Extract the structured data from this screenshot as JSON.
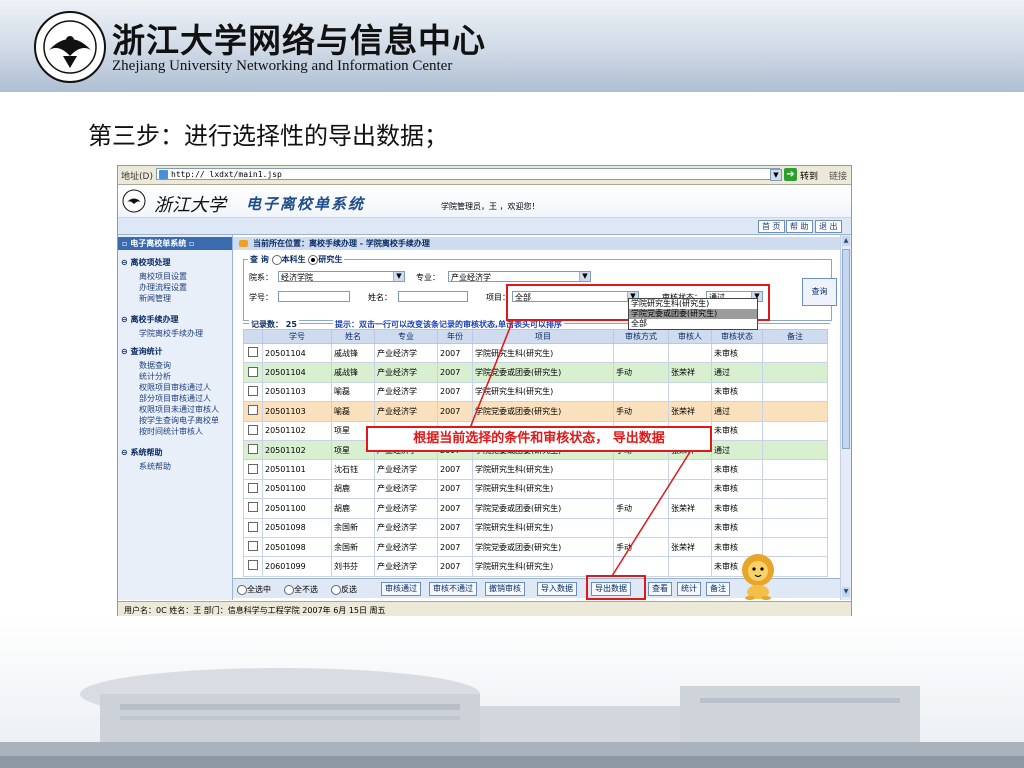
{
  "slide": {
    "title_cn": "浙江大学网络与信息中心",
    "title_en": "Zhejiang University Networking and Information Center",
    "step_title": "第三步：进行选择性的导出数据；"
  },
  "browser": {
    "address_label": "地址(D)",
    "url": "http://                  lxdxt/main1.jsp",
    "go_label": "转到",
    "links_label": "链接"
  },
  "app": {
    "calligraphy": "浙江大学",
    "name": "电子离校单系统",
    "welcome": "学院管理员，王      ，欢迎您！",
    "nav": [
      "首 页",
      "帮 助",
      "退 出"
    ]
  },
  "sidebar": {
    "header": "▫ 电子离校单系统 ▫",
    "sections": [
      {
        "title": "离校项处理",
        "items": [
          "离校项目设置",
          "办理流程设置",
          "新闻管理"
        ]
      },
      {
        "title": "离校手续办理",
        "items": [
          "学院离校手续办理"
        ]
      },
      {
        "title": "查询统计",
        "items": [
          "数据查询",
          "统计分析",
          "权限项目审核通过人",
          "部分项目审核通过人",
          "权限项目未通过审核人",
          "按学生查询电子离校单",
          "按时间统计审核人"
        ]
      },
      {
        "title": "系统帮助",
        "items": [
          "系统帮助"
        ]
      }
    ]
  },
  "breadcrumb": "当前所在位置：离校手续办理 - 学院离校手续办理",
  "query": {
    "legend": "查 询",
    "radio_undergrad": "本科生",
    "radio_grad": "研究生",
    "dept_label": "院系：",
    "dept_value": "经济学院",
    "major_label": "专业：",
    "major_value": "产业经济学",
    "id_label": "学号：",
    "name_label": "姓名：",
    "item_label": "项目：",
    "item_value": "全部",
    "status_label": "审核状态：",
    "status_value": "通过",
    "search_button": "查询",
    "dropdown_options": [
      "学院研究生科(研究生)",
      "学院党委或团委(研究生)",
      "全部"
    ]
  },
  "records": {
    "count_label": "记录数：",
    "count": "25",
    "tip": "提示：双击一行可以改变该条记录的审核状态,单击表头可以排序",
    "columns": [
      "",
      "学号",
      "姓名",
      "专业",
      "年份",
      "项目",
      "审核方式",
      "审核人",
      "审核状态",
      "备注"
    ],
    "rows": [
      {
        "style": "white",
        "cells": [
          "20501104",
          "戚战锋",
          "产业经济学",
          "2007",
          "学院研究生科(研究生)",
          "",
          "",
          "未审核",
          ""
        ]
      },
      {
        "style": "green",
        "cells": [
          "20501104",
          "戚战锋",
          "产业经济学",
          "2007",
          "学院党委或团委(研究生)",
          "手动",
          "张荣祥",
          "通过",
          ""
        ]
      },
      {
        "style": "white",
        "cells": [
          "20501103",
          "喻磊",
          "产业经济学",
          "2007",
          "学院研究生科(研究生)",
          "",
          "",
          "未审核",
          ""
        ]
      },
      {
        "style": "orange",
        "cells": [
          "20501103",
          "喻磊",
          "产业经济学",
          "2007",
          "学院党委或团委(研究生)",
          "手动",
          "张荣祥",
          "通过",
          ""
        ]
      },
      {
        "style": "white",
        "cells": [
          "20501102",
          "项星",
          "产业经济学",
          "2007",
          "学院研究生科(研究生)",
          "",
          "",
          "未审核",
          ""
        ]
      },
      {
        "style": "green",
        "cells": [
          "20501102",
          "项星",
          "产业经济学",
          "2007",
          "学院党委或团委(研究生)",
          "手动",
          "张荣祥",
          "通过",
          ""
        ]
      },
      {
        "style": "white",
        "cells": [
          "20501101",
          "沈石钰",
          "产业经济学",
          "2007",
          "学院研究生科(研究生)",
          "",
          "",
          "未审核",
          ""
        ]
      },
      {
        "style": "white",
        "cells": [
          "20501100",
          "胡鹿",
          "产业经济学",
          "2007",
          "学院研究生科(研究生)",
          "",
          "",
          "未审核",
          ""
        ]
      },
      {
        "style": "white",
        "cells": [
          "20501100",
          "胡鹿",
          "产业经济学",
          "2007",
          "学院党委或团委(研究生)",
          "手动",
          "张荣祥",
          "未审核",
          ""
        ]
      },
      {
        "style": "white",
        "cells": [
          "20501098",
          "余国新",
          "产业经济学",
          "2007",
          "学院研究生科(研究生)",
          "",
          "",
          "未审核",
          ""
        ]
      },
      {
        "style": "white",
        "cells": [
          "20501098",
          "余国新",
          "产业经济学",
          "2007",
          "学院党委或团委(研究生)",
          "手动",
          "张荣祥",
          "未审核",
          ""
        ]
      },
      {
        "style": "white",
        "cells": [
          "20601099",
          "刘书芬",
          "产业经济学",
          "2007",
          "学院研究生科(研究生)",
          "",
          "",
          "未审核",
          ""
        ]
      }
    ]
  },
  "toolbar": {
    "select_all": "全选中",
    "select_none": "全不选",
    "invert": "反选",
    "buttons": [
      "审核通过",
      "审核不通过",
      "撤销审核",
      "导入数据",
      "导出数据",
      "查看",
      "统计",
      "备注"
    ]
  },
  "statusbar": "用户名：0C           姓名：王       部门：信息科学与工程学院    2007年 6月 15日 周五",
  "annotation": "根据当前选择的条件和审核状态，  导出数据",
  "colors": {
    "annotation_red": "#e01818",
    "row_green": "#d8efd0",
    "row_orange": "#fbe0bd",
    "app_blue": "#1f4d8c"
  }
}
